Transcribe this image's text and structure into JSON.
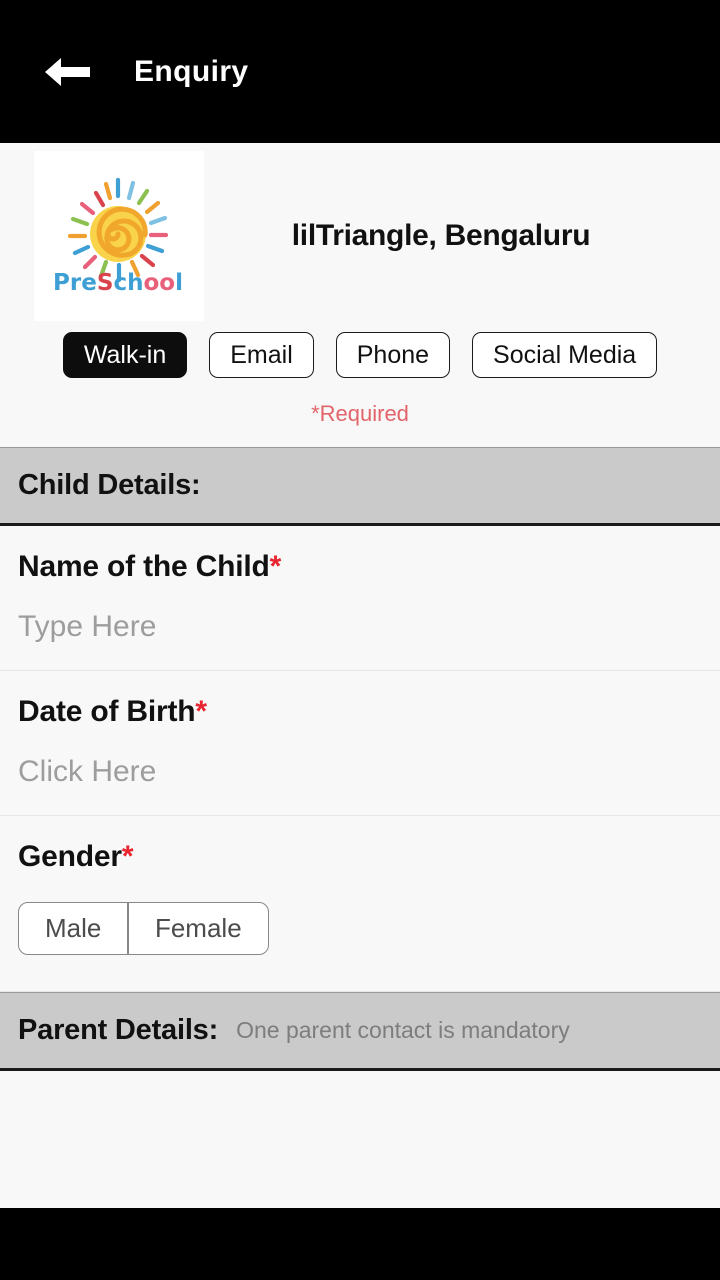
{
  "appbar": {
    "back_icon": "arrow-left-icon",
    "title": "Enquiry"
  },
  "school": {
    "logo_alt": "preschool-sun-logo",
    "logo_text": "PreSchool",
    "name": "lilTriangle, Bengaluru"
  },
  "source_types": {
    "options": [
      {
        "label": "Walk-in",
        "selected": true
      },
      {
        "label": "Email",
        "selected": false
      },
      {
        "label": "Phone",
        "selected": false
      },
      {
        "label": "Social Media",
        "selected": false
      }
    ],
    "required_note": "*Required"
  },
  "child_section": {
    "title": "Child Details:",
    "fields": {
      "name": {
        "label": "Name of the Child",
        "required_mark": "*",
        "placeholder": "Type Here",
        "value": ""
      },
      "dob": {
        "label": "Date of Birth",
        "required_mark": "*",
        "placeholder": "Click Here",
        "value": ""
      },
      "gender": {
        "label": "Gender",
        "required_mark": "*",
        "options": [
          {
            "label": "Male",
            "selected": false
          },
          {
            "label": "Female",
            "selected": false
          }
        ]
      }
    }
  },
  "parent_section": {
    "title": "Parent Details:",
    "hint": "One parent contact is mandatory"
  },
  "colors": {
    "appbar_bg": "#000000",
    "page_bg": "#f8f8f8",
    "band_bg": "#cacaca",
    "required_red": "#e8242f",
    "note_red": "#e2646a",
    "selected_pill_bg": "#0d0d0d"
  }
}
